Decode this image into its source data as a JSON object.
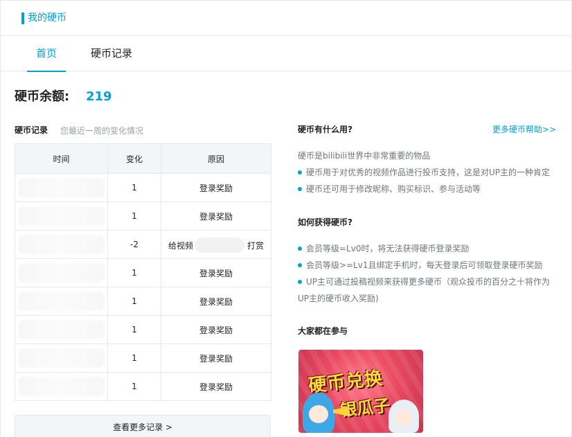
{
  "header": {
    "title": "我的硬币"
  },
  "tabs": [
    {
      "label": "首页",
      "active": true
    },
    {
      "label": "硬币记录",
      "active": false
    }
  ],
  "balance": {
    "label": "硬币余额:",
    "value": "219"
  },
  "records": {
    "title": "硬币记录",
    "subtitle": "您最近一周的变化情况",
    "columns": [
      "时间",
      "变化",
      "原因"
    ],
    "rows": [
      {
        "time": "",
        "change": "1",
        "reason": "登录奖励"
      },
      {
        "time": "",
        "change": "1",
        "reason": "登录奖励"
      },
      {
        "time": "",
        "change": "-2",
        "reason_pre": "给视频",
        "reason_post": "打赏"
      },
      {
        "time": "",
        "change": "1",
        "reason": "登录奖励"
      },
      {
        "time": "",
        "change": "1",
        "reason": "登录奖励"
      },
      {
        "time": "",
        "change": "1",
        "reason": "登录奖励"
      },
      {
        "time": "",
        "change": "1",
        "reason": "登录奖励"
      },
      {
        "time": "",
        "change": "1",
        "reason": "登录奖励"
      }
    ],
    "more_button": "查看更多记录 >"
  },
  "info": {
    "usage_title": "硬币有什么用?",
    "help_link": "更多硬币帮助>>",
    "usage_intro": "硬币是bilibili世界中非常重要的物品",
    "usage_bullets": [
      "硬币用于对优秀的视频作品进行投币支持，这是对UP主的一种肯定",
      "硬币还可用于修改昵称、购买标识、参与活动等"
    ],
    "obtain_title": "如何获得硬币?",
    "obtain_bullets": [
      "会员等级=Lv0时，将无法获得硬币登录奖励",
      "会员等级>=Lv1且绑定手机时，每天登录后可领取登录硬币奖励",
      "UP主可通过投稿视频来获得更多硬币（观众投币的百分之十将作为UP主的硬币收入奖励)"
    ],
    "events_title": "大家都在参与",
    "banner": {
      "line1": "硬币兑换",
      "line2": "银瓜子"
    }
  },
  "colors": {
    "accent": "#00a1d6",
    "border": "#e5e9ef",
    "muted": "#99a2aa",
    "text": "#222222"
  },
  "icons": {
    "header_bar": "title-accent-bar",
    "bullet": "blue-dot"
  }
}
